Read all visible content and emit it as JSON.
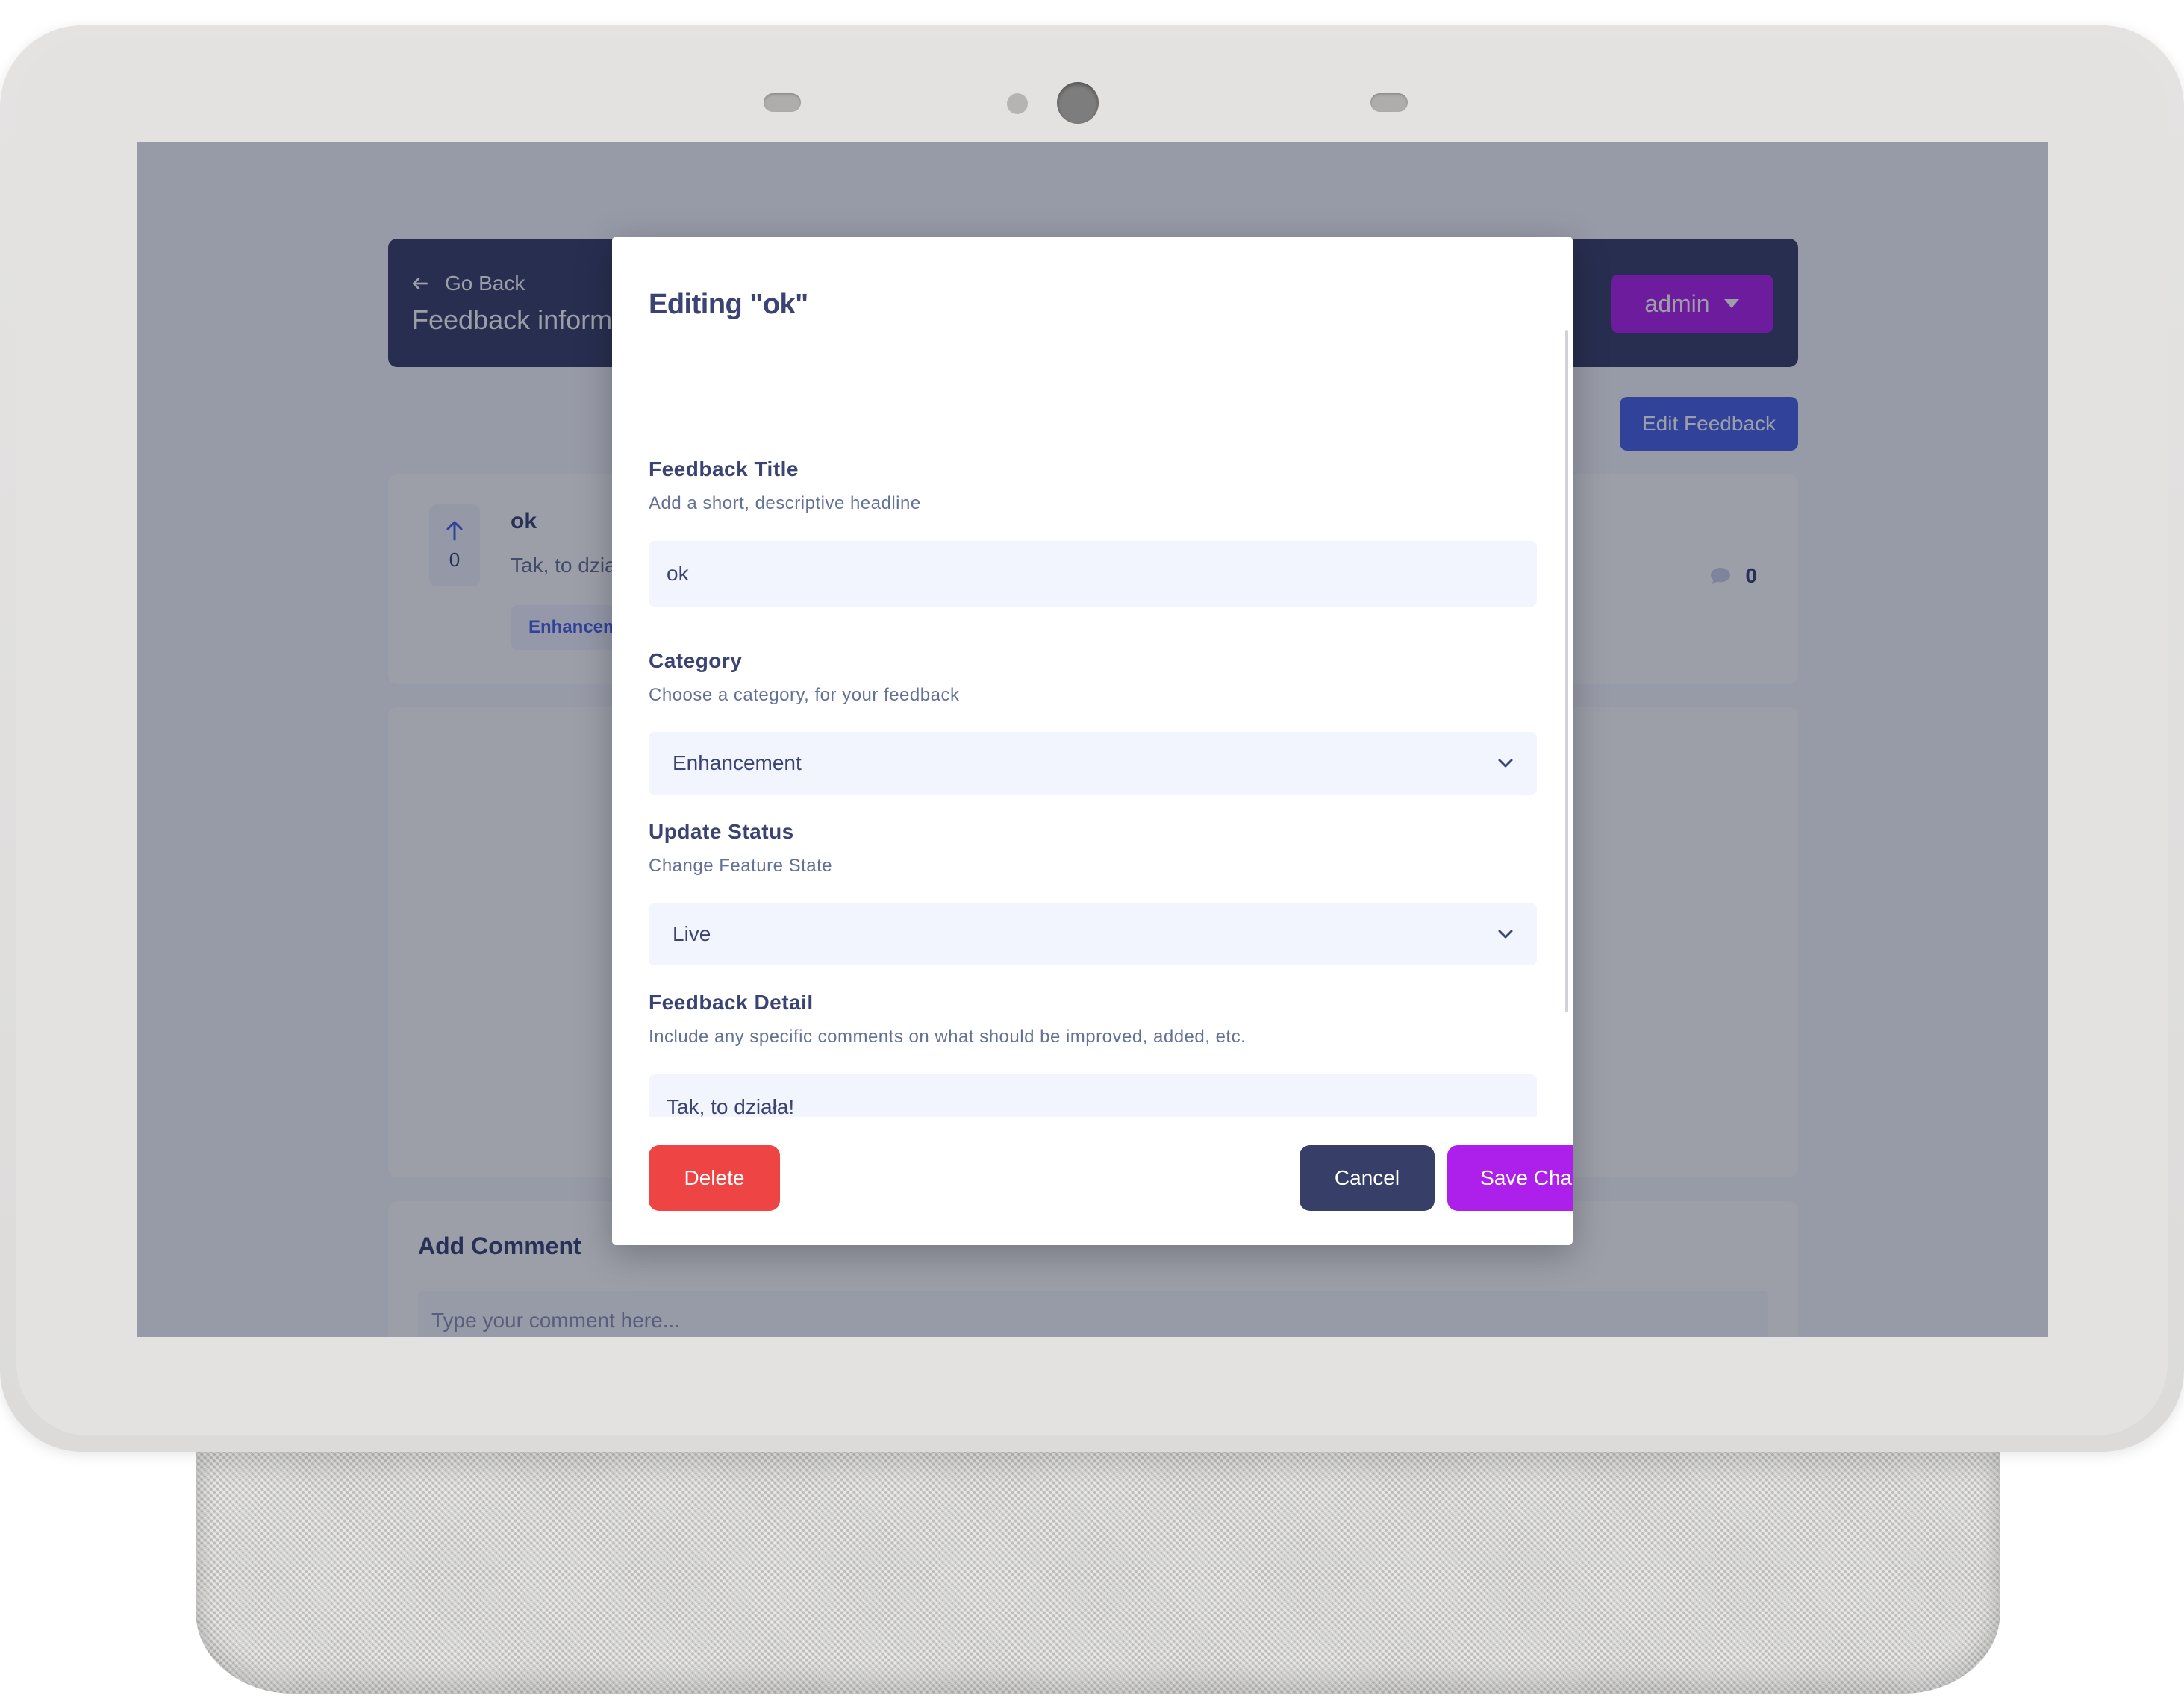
{
  "header": {
    "go_back_label": "Go Back",
    "title": "Feedback information",
    "user_label": "admin"
  },
  "toolbar": {
    "edit_feedback_label": "Edit Feedback"
  },
  "feedback": {
    "upvotes": "0",
    "title": "ok",
    "description": "Tak, to działa!",
    "category_tag": "Enhancement",
    "comment_count": "0"
  },
  "add_comment": {
    "title": "Add Comment",
    "placeholder": "Type your comment here..."
  },
  "modal": {
    "title": "Editing \"ok\"",
    "title_field": {
      "label": "Feedback Title",
      "help": "Add a short, descriptive headline",
      "value": "ok"
    },
    "category_field": {
      "label": "Category",
      "help": "Choose a category, for your feedback",
      "value": "Enhancement"
    },
    "status_field": {
      "label": "Update Status",
      "help": "Change Feature State",
      "value": "Live"
    },
    "detail_field": {
      "label": "Feedback Detail",
      "help": "Include any specific comments on what should be improved, added, etc.",
      "value": "Tak, to działa!"
    },
    "delete_label": "Delete",
    "cancel_label": "Cancel",
    "save_label": "Save Changes"
  },
  "colors": {
    "header_bg": "#373f68",
    "admin_accent": "#ad1fea",
    "edit_button": "#4661e6",
    "delete_button": "#ef4444",
    "cancel_button": "#373f68",
    "save_button": "#ad1fea",
    "field_bg": "#f2f4fe"
  },
  "icons": {
    "back": "arrow-left-icon",
    "admin_menu": "caret-down-icon",
    "upvote": "arrow-up-icon",
    "comments": "speech-bubble-icon",
    "select": "chevron-down-icon"
  }
}
